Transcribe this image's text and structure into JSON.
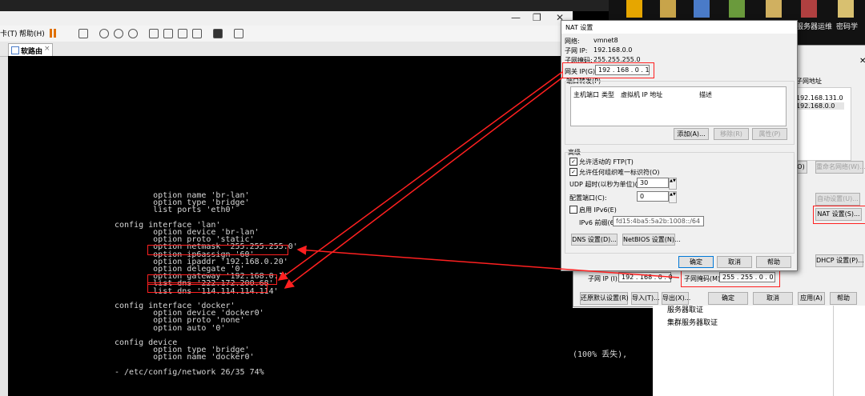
{
  "desktop": {
    "icon_labels": [
      "服务器运维",
      "密码学"
    ]
  },
  "vmware": {
    "menu": [
      "卡(T)",
      "帮助(H)"
    ],
    "tab_title": "软路由",
    "win_min": "—",
    "win_max": "❐",
    "win_close": "✕"
  },
  "terminal": {
    "lines": [
      "        option name 'br-lan'",
      "        option type 'bridge'",
      "        list ports 'eth0'",
      "",
      "config interface 'lan'",
      "        option device 'br-lan'",
      "        option proto 'static'",
      "        option netmask '255.255.255.0'",
      "        option ip6assign '60'",
      "        option ipaddr '192.168.0.20'",
      "        option delegate '0'",
      "        option gateway '192.168.0.1'",
      "        list dns '222.172.200.68'",
      "        list dns '114.114.114.114'",
      "",
      "config interface 'docker'",
      "        option device 'docker0'",
      "        option proto 'none'",
      "        option auto '0'",
      "",
      "config device",
      "        option type 'bridge'",
      "        option name 'docker0'",
      "",
      "- /etc/config/network 26/35 74%"
    ],
    "lower_text": "(100% 丢失),"
  },
  "nat_dialog": {
    "title": "NAT 设置",
    "network_label": "网络:",
    "network_value": "vmnet8",
    "subnet_ip_label": "子网 IP:",
    "subnet_ip_value": "192.168.0.0",
    "subnet_mask_label": "子网掩码:",
    "subnet_mask_value": "255.255.255.0",
    "gateway_label": "网关 IP(G):",
    "gateway_value": "192 . 168 . 0 . 1",
    "port_forward_label": "端口转发(P)",
    "pf_columns": [
      "主机端口",
      "类型",
      "虚拟机 IP 地址",
      "描述"
    ],
    "add_button": "添加(A)...",
    "remove_button": "移除(R)",
    "properties_button": "属性(P)",
    "advanced_label": "高级",
    "allow_ftp": "允许活动的 FTP(T)",
    "allow_oui": "允许任何组织唯一标识符(O)",
    "udp_timeout_label": "UDP 超时(以秒为单位)(U):",
    "udp_timeout_value": "30",
    "config_port_label": "配置端口(C):",
    "config_port_value": "0",
    "enable_ipv6": "启用 IPv6(E)",
    "ipv6_prefix_label": "IPv6 前缀(6):",
    "ipv6_prefix_value": "fd15:4ba5:5a2b:1008::/64",
    "dns_button": "DNS 设置(D)...",
    "netbios_button": "NetBIOS 设置(N)...",
    "ok_button": "确定",
    "cancel_button": "取消",
    "help_button": "帮助"
  },
  "network_editor": {
    "subnet_header": "子网地址",
    "subnets": [
      "192.168.131.0",
      "192.168.0.0"
    ],
    "btn_o": "O)",
    "rename_button": "重命名网络(W)...",
    "auto_settings_button": "自动设置(U)...",
    "nat_settings_button": "NAT 设置(S)...",
    "dhcp_settings_button": "DHCP 设置(P)...",
    "subnet_ip_label": "子网 IP (I):",
    "subnet_ip_value": "192 . 168 . 0 . 0",
    "subnet_mask_label": "子网掩码(M):",
    "subnet_mask_value": "255 . 255 . 0 . 0",
    "restore_defaults": "还原默认设置(R)",
    "import_button": "导入(T)...",
    "export_button": "导出(X)...",
    "ok_button": "确定",
    "cancel_button": "取消",
    "apply_button": "应用(A)",
    "help_button": "帮助"
  },
  "side_texts": [
    "服务器取证",
    "集群服务器取证"
  ],
  "colors": {
    "annotation": "#ff2020",
    "terminal_text": "#d8d8d8",
    "dialog_bg": "#f0f0f0"
  }
}
